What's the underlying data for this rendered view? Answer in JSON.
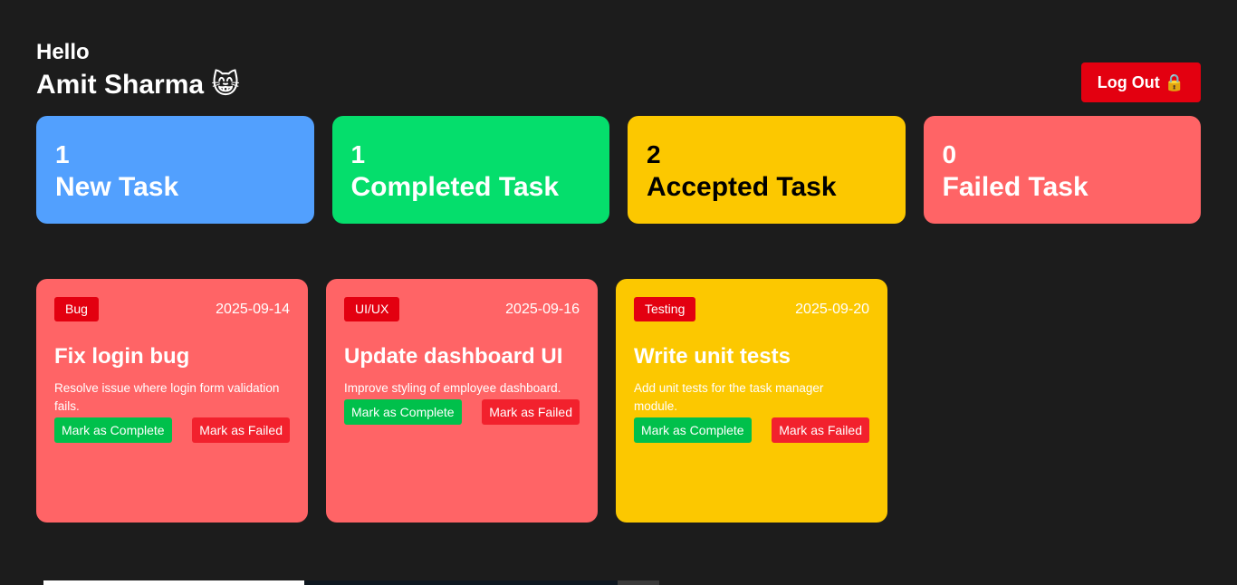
{
  "greeting": {
    "hello": "Hello",
    "name": "Amit Sharma 😸"
  },
  "logout": {
    "label": "Log Out 🔒"
  },
  "stats": [
    {
      "count": "1",
      "label": "New Task",
      "color": "#52a0fe",
      "text_color": "#ffffff"
    },
    {
      "count": "1",
      "label": "Completed Task",
      "color": "#05de6c",
      "text_color": "#ffffff"
    },
    {
      "count": "2",
      "label": "Accepted Task",
      "color": "#fcc800",
      "text_color": "#000000"
    },
    {
      "count": "0",
      "label": "Failed Task",
      "color": "#ff6466",
      "text_color": "#ffffff"
    }
  ],
  "tasks": [
    {
      "tag": "Bug",
      "date": "2025-09-14",
      "title": "Fix login bug",
      "description": "Resolve issue where login form validation fails.",
      "color": "#ff6466",
      "complete_label": "Mark as Complete",
      "failed_label": "Mark as Failed"
    },
    {
      "tag": "UI/UX",
      "date": "2025-09-16",
      "title": "Update dashboard UI",
      "description": "Improve styling of employee dashboard.",
      "color": "#ff6466",
      "complete_label": "Mark as Complete",
      "failed_label": "Mark as Failed"
    },
    {
      "tag": "Testing",
      "date": "2025-09-20",
      "title": "Write unit tests",
      "description": "Add unit tests for the task manager module.",
      "color": "#fcc800",
      "complete_label": "Mark as Complete",
      "failed_label": "Mark as Failed"
    }
  ]
}
